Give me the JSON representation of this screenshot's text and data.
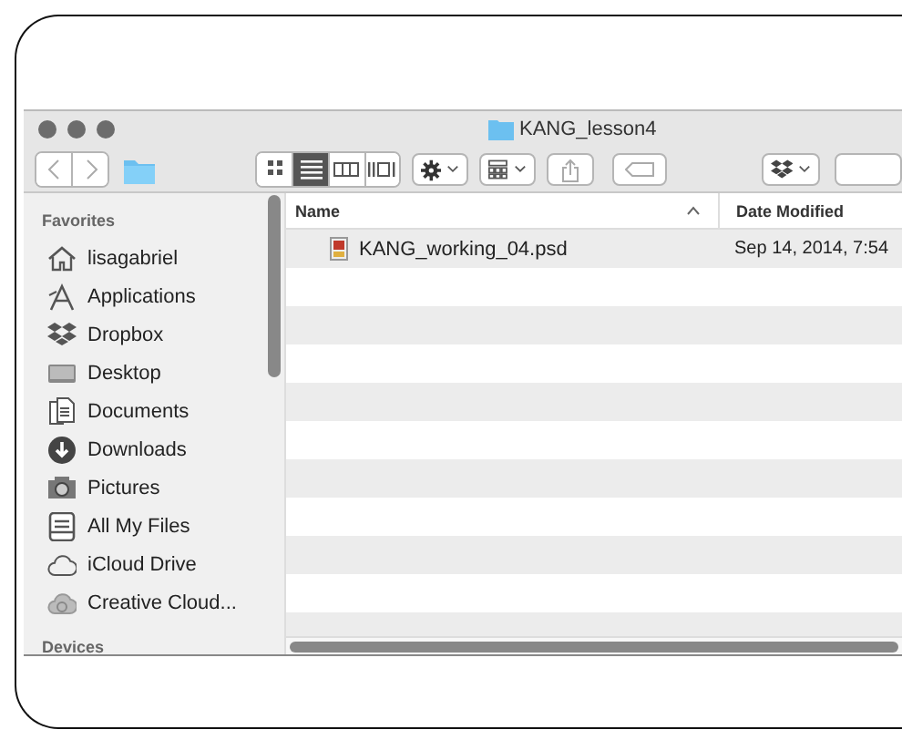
{
  "window": {
    "title": "KANG_lesson4"
  },
  "toolbar": {
    "view_modes": [
      {
        "kind": "icons",
        "selected": false
      },
      {
        "kind": "list",
        "selected": true
      },
      {
        "kind": "columns",
        "selected": false
      },
      {
        "kind": "coverflow",
        "selected": false
      }
    ]
  },
  "sidebar": {
    "sections": [
      {
        "title": "Favorites",
        "items": [
          {
            "label": "lisagabriel",
            "kind": "home"
          },
          {
            "label": "Applications",
            "kind": "apps"
          },
          {
            "label": "Dropbox",
            "kind": "dropbox"
          },
          {
            "label": "Desktop",
            "kind": "desktop"
          },
          {
            "label": "Documents",
            "kind": "documents"
          },
          {
            "label": "Downloads",
            "kind": "downloads"
          },
          {
            "label": "Pictures",
            "kind": "pictures"
          },
          {
            "label": "All My Files",
            "kind": "allfiles"
          },
          {
            "label": "iCloud Drive",
            "kind": "icloud"
          },
          {
            "label": "Creative Cloud...",
            "kind": "creativecloud"
          }
        ]
      },
      {
        "title": "Devices"
      }
    ]
  },
  "table": {
    "columns": [
      {
        "label": "Name",
        "sorted": true
      },
      {
        "label": "Date Modified",
        "sorted": false
      }
    ],
    "rows": [
      {
        "name": "KANG_working_04.psd",
        "date": "Sep 14, 2014, 7:54"
      }
    ]
  }
}
